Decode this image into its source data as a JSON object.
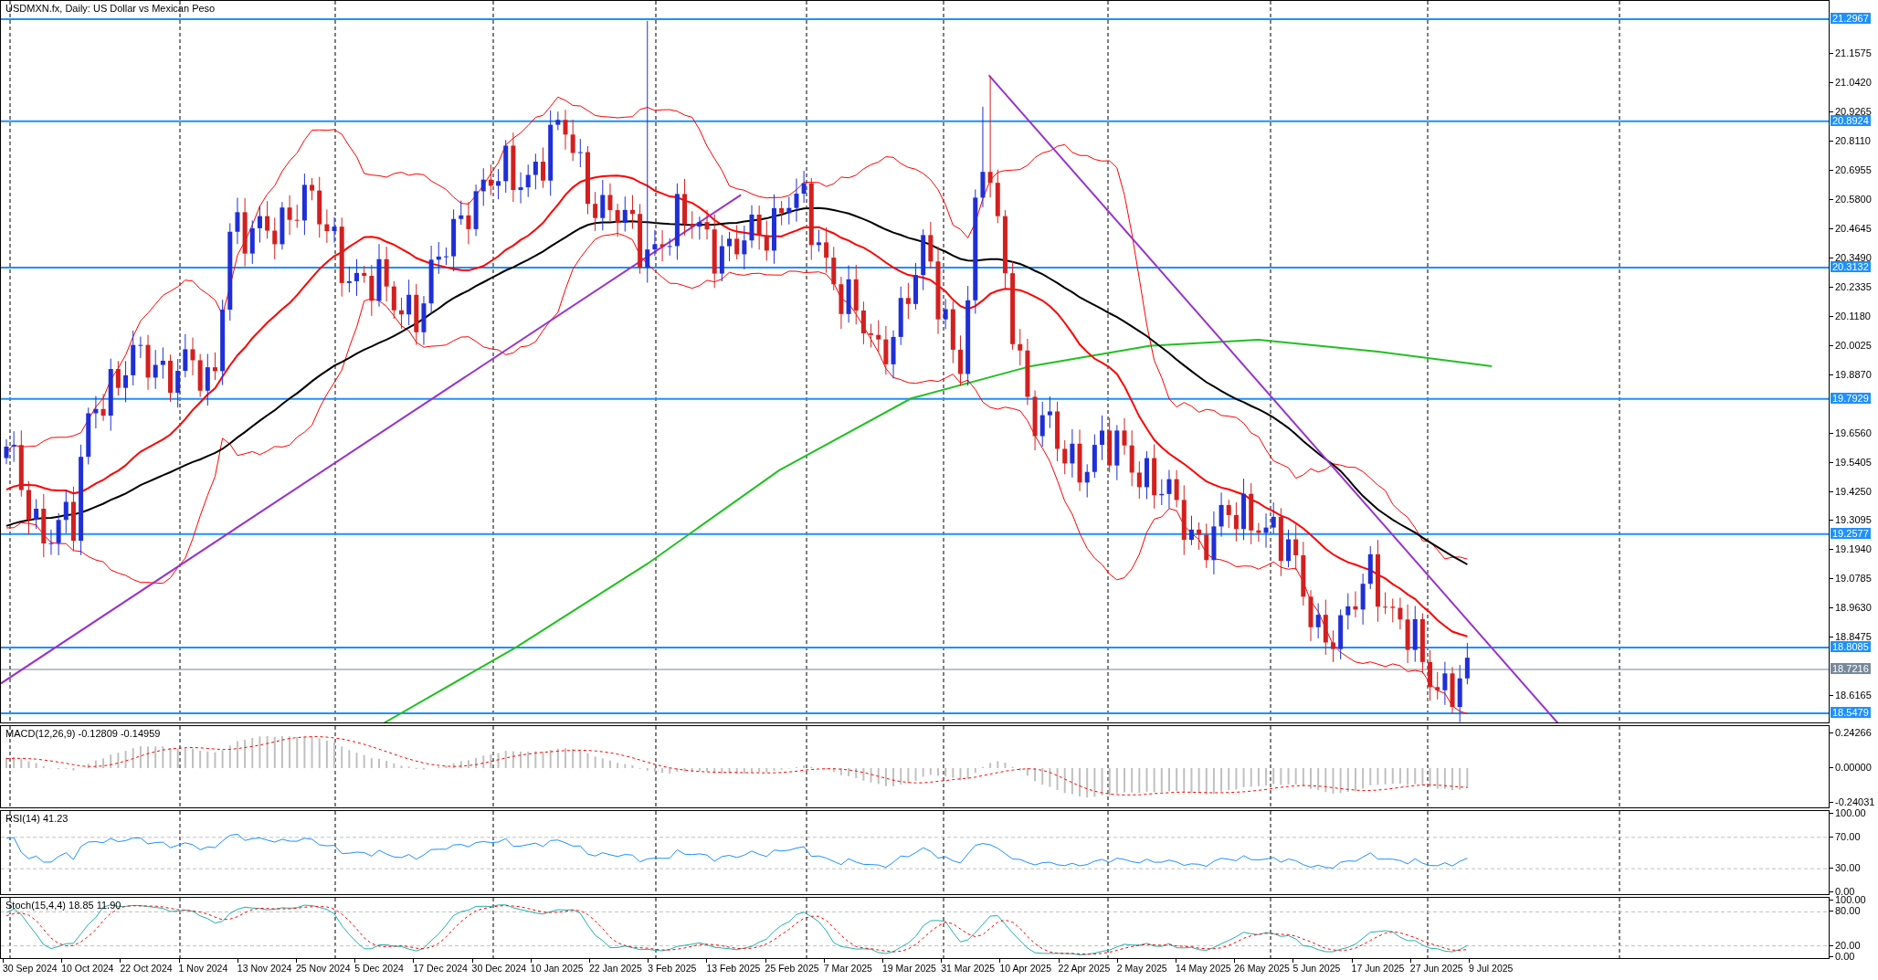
{
  "chart": {
    "title": "USDMXN.fx, Daily:  US Dollar vs Mexican Peso",
    "price_ticks": [
      "21.1575",
      "21.0420",
      "20.9265",
      "20.8110",
      "20.6955",
      "20.5800",
      "20.4645",
      "20.3490",
      "20.2335",
      "20.1180",
      "20.0025",
      "19.8870",
      "19.6560",
      "19.5405",
      "19.4250",
      "19.3095",
      "19.1940",
      "19.0785",
      "18.9630",
      "18.8475",
      "18.6165"
    ],
    "levels": [
      {
        "label": "21.2967",
        "kind": "level"
      },
      {
        "label": "20.8924",
        "kind": "level"
      },
      {
        "label": "20.3132",
        "kind": "level"
      },
      {
        "label": "19.7929",
        "kind": "level"
      },
      {
        "label": "19.2577",
        "kind": "level"
      },
      {
        "label": "18.8085",
        "kind": "level"
      },
      {
        "label": "18.7216",
        "kind": "current"
      },
      {
        "label": "18.5479",
        "kind": "level"
      }
    ]
  },
  "macd": {
    "label": "MACD(12,26,9) -0.12809 -0.14959",
    "ticks": [
      "0.24266",
      "0.00000",
      "-0.24031"
    ]
  },
  "rsi": {
    "label": "RSI(14) 41.23",
    "ticks": [
      "100.00",
      "70.00",
      "30.00",
      "0.00"
    ]
  },
  "stoch": {
    "label": "Stoch(15,4,4) 18.85 11.90",
    "ticks": [
      "100.00",
      "80.00",
      "20.00",
      "0.00"
    ]
  },
  "dates": [
    "30 Sep 2024",
    "10 Oct 2024",
    "22 Oct 2024",
    "1 Nov 2024",
    "13 Nov 2024",
    "25 Nov 2024",
    "5 Dec 2024",
    "17 Dec 2024",
    "30 Dec 2024",
    "10 Jan 2025",
    "22 Jan 2025",
    "3 Feb 2025",
    "13 Feb 2025",
    "25 Feb 2025",
    "7 Mar 2025",
    "19 Mar 2025",
    "31 Mar 2025",
    "10 Apr 2025",
    "22 Apr 2025",
    "2 May 2025",
    "14 May 2025",
    "26 May 2025",
    "5 Jun 2025",
    "17 Jun 2025",
    "27 Jun 2025",
    "9 Jul 2025"
  ]
}
